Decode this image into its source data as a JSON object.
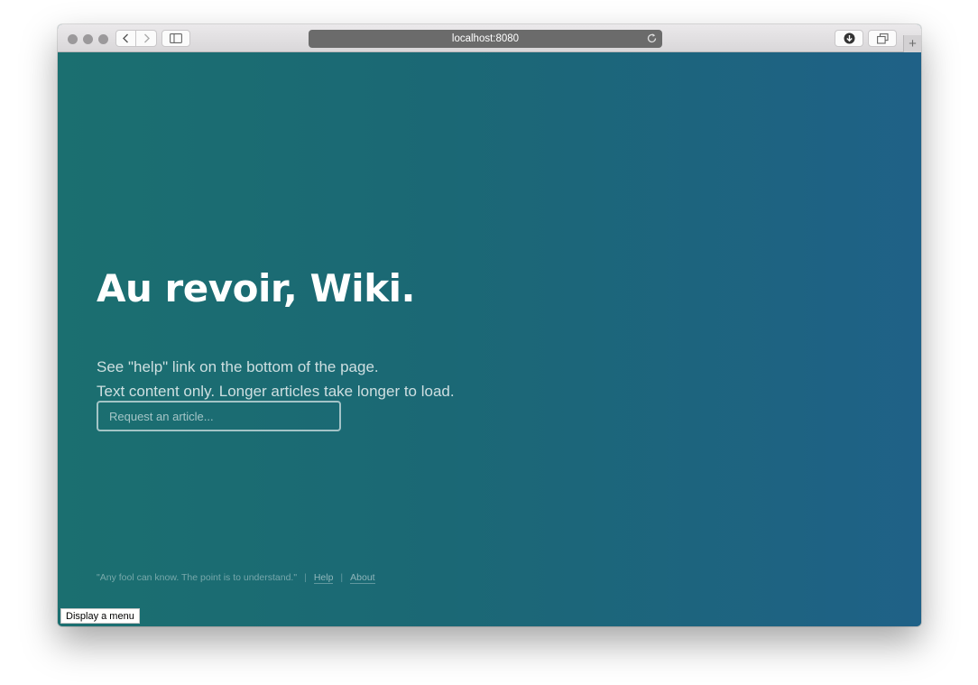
{
  "browser": {
    "url": "localhost:8080",
    "new_tab_label": "+"
  },
  "page": {
    "title": "Au revoir, Wiki.",
    "subtitle_lines": [
      "See \"help\" link on the bottom of the page.",
      "Text content only. Longer articles take longer to load."
    ],
    "search": {
      "placeholder": "Request an article...",
      "value": ""
    },
    "footer": {
      "quote": "\"Any fool can know. The point is to understand.\"",
      "links": [
        "Help",
        "About"
      ]
    }
  },
  "tooltip": "Display a menu",
  "colors": {
    "gradient_start": "#1b6f70",
    "gradient_end": "#1f6187",
    "url_bar": "#6b6b6b"
  }
}
